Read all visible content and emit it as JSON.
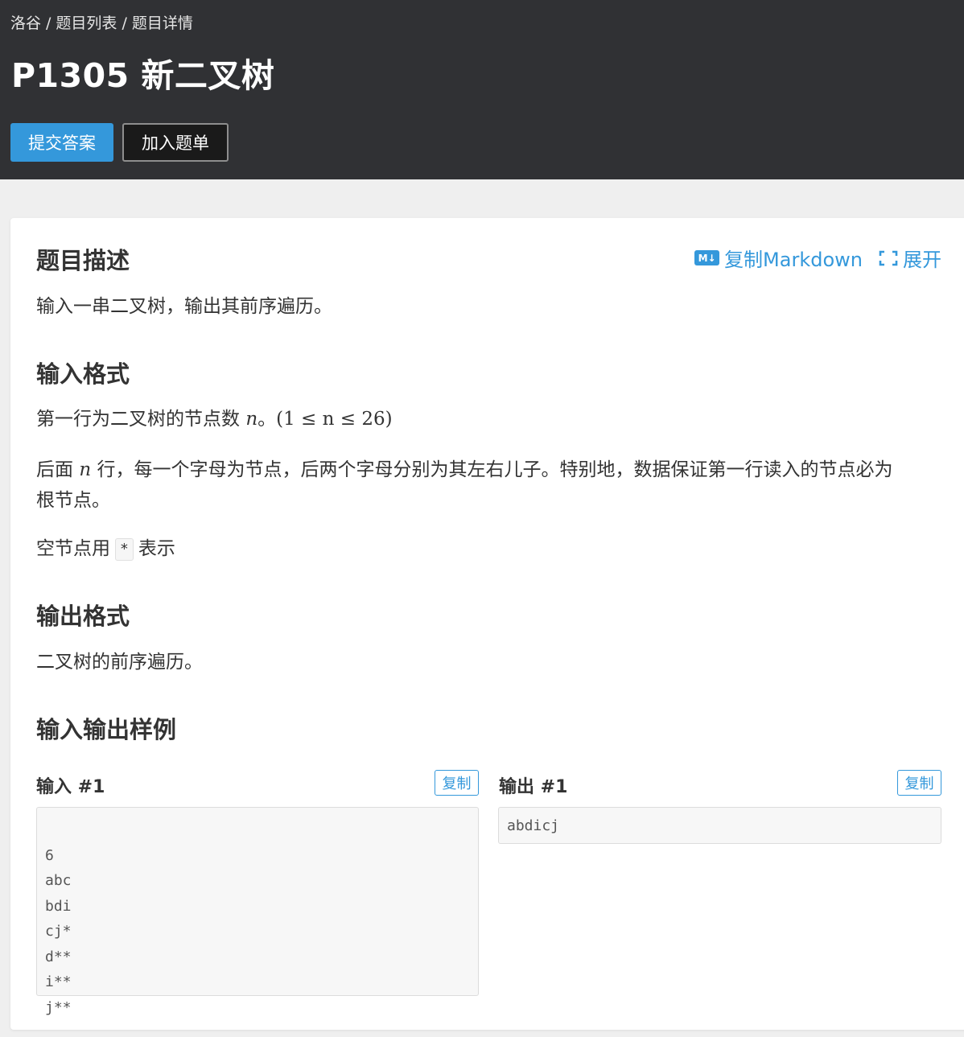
{
  "breadcrumb": {
    "home": "洛谷",
    "list": "题目列表",
    "detail": "题目详情",
    "separator": "/"
  },
  "problem": {
    "title": "P1305 新二叉树"
  },
  "actions": {
    "submit": "提交答案",
    "add_to_list": "加入题单"
  },
  "toolbar": {
    "copy_markdown": "复制Markdown",
    "copy_markdown_icon_text": "M↓",
    "expand": "展开"
  },
  "sections": {
    "description_title": "题目描述",
    "description_text": "输入一串二叉树，输出其前序遍历。",
    "input_format_title": "输入格式",
    "input_line1_prefix": "第一行为二叉树的节点数",
    "input_line1_var": "n",
    "input_line1_suffix": "。",
    "input_line1_math": "(1 ≤ n ≤ 26)",
    "input_line2_prefix": "后面",
    "input_line2_var": "n",
    "input_line2_text": "行，每一个字母为节点，后两个字母分别为其左右儿子。特别地，数据保证第一行读入的节点必为",
    "input_line2_wrap": "根节点。",
    "input_line3_prefix": "空节点用",
    "input_line3_code": "*",
    "input_line3_suffix": "表示",
    "output_format_title": "输出格式",
    "output_text": "二叉树的前序遍历。",
    "samples_title": "输入输出样例"
  },
  "samples": {
    "input_label": "输入 #1",
    "output_label": "输出 #1",
    "copy_label": "复制",
    "input_lines": [
      "6",
      "abc",
      "bdi",
      "cj*",
      "d**",
      "i**",
      "j**"
    ],
    "output_lines": [
      "abdicj"
    ]
  }
}
